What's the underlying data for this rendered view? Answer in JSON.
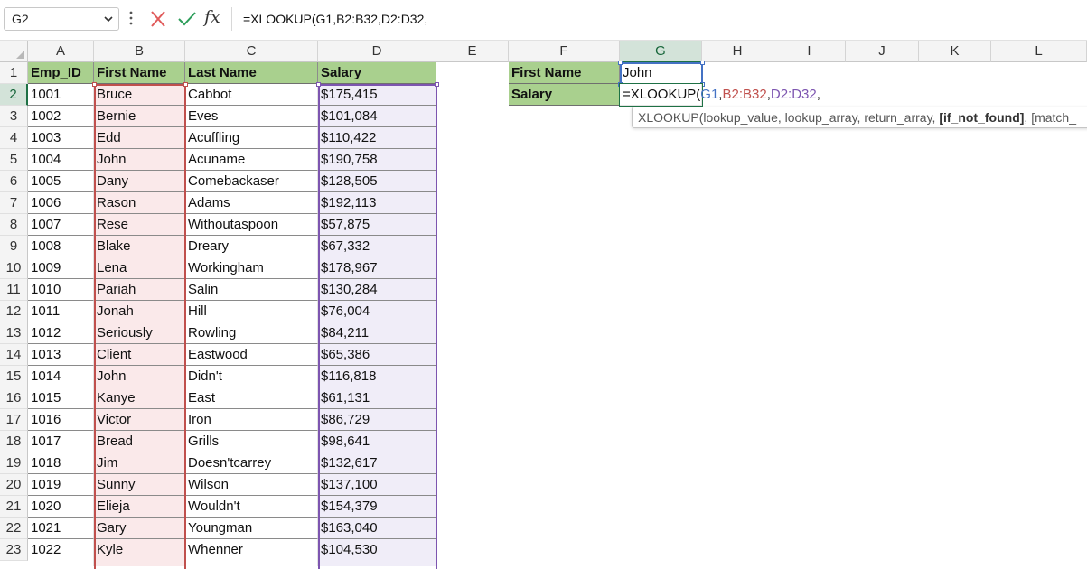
{
  "formula_bar": {
    "name_box": "G2",
    "formula": "=XLOOKUP(G1,B2:B32,D2:D32,",
    "icons": [
      "chevron-down-icon",
      "more-vertical-icon",
      "cancel-icon",
      "enter-check-icon",
      "insert-function-icon"
    ]
  },
  "columns": [
    "A",
    "B",
    "C",
    "D",
    "E",
    "F",
    "G",
    "H",
    "I",
    "J",
    "K",
    "L"
  ],
  "rows": [
    "1",
    "2",
    "3",
    "4",
    "5",
    "6",
    "7",
    "8",
    "9",
    "10",
    "11",
    "12",
    "13",
    "14",
    "15",
    "16",
    "17",
    "18",
    "19",
    "20",
    "21",
    "22",
    "23"
  ],
  "headers": {
    "emp_id": "Emp_ID",
    "first_name": "First Name",
    "last_name": "Last Name",
    "salary": "Salary"
  },
  "employees": [
    {
      "id": "1001",
      "first": "Bruce",
      "last": "Cabbot",
      "salary": "$175,415"
    },
    {
      "id": "1002",
      "first": "Bernie",
      "last": "Eves",
      "salary": "$101,084"
    },
    {
      "id": "1003",
      "first": "Edd",
      "last": "Acuffling",
      "salary": "$110,422"
    },
    {
      "id": "1004",
      "first": "John",
      "last": "Acuname",
      "salary": "$190,758"
    },
    {
      "id": "1005",
      "first": "Dany",
      "last": "Comebackaser",
      "salary": "$128,505"
    },
    {
      "id": "1006",
      "first": "Rason",
      "last": "Adams",
      "salary": "$192,113"
    },
    {
      "id": "1007",
      "first": "Rese",
      "last": "Withoutaspoon",
      "salary": "$57,875"
    },
    {
      "id": "1008",
      "first": "Blake",
      "last": "Dreary",
      "salary": "$67,332"
    },
    {
      "id": "1009",
      "first": "Lena",
      "last": "Workingham",
      "salary": "$178,967"
    },
    {
      "id": "1010",
      "first": "Pariah",
      "last": "Salin",
      "salary": "$130,284"
    },
    {
      "id": "1011",
      "first": "Jonah",
      "last": "Hill",
      "salary": "$76,004"
    },
    {
      "id": "1012",
      "first": "Seriously",
      "last": "Rowling",
      "salary": "$84,211"
    },
    {
      "id": "1013",
      "first": "Client",
      "last": "Eastwood",
      "salary": "$65,386"
    },
    {
      "id": "1014",
      "first": "John",
      "last": "Didn't",
      "salary": "$116,818"
    },
    {
      "id": "1015",
      "first": "Kanye",
      "last": "East",
      "salary": "$61,131"
    },
    {
      "id": "1016",
      "first": "Victor",
      "last": "Iron",
      "salary": "$86,729"
    },
    {
      "id": "1017",
      "first": "Bread",
      "last": "Grills",
      "salary": "$98,641"
    },
    {
      "id": "1018",
      "first": "Jim",
      "last": "Doesn'tcarrey",
      "salary": "$132,617"
    },
    {
      "id": "1019",
      "first": "Sunny",
      "last": "Wilson",
      "salary": "$137,100"
    },
    {
      "id": "1020",
      "first": "Elieja",
      "last": "Wouldn't",
      "salary": "$154,379"
    },
    {
      "id": "1021",
      "first": "Gary",
      "last": "Youngman",
      "salary": "$163,040"
    },
    {
      "id": "1022",
      "first": "Kyle",
      "last": "Whenner",
      "salary": "$104,530"
    }
  ],
  "lookup": {
    "first_name_label": "First Name",
    "first_name_value": "John",
    "salary_label": "Salary",
    "editing": {
      "prefix": "=XLOOKUP(",
      "ref1": "G1",
      "sep1": ",",
      "ref2": "B2:B32",
      "sep2": ",",
      "ref3": "D2:D32",
      "sep3": ","
    }
  },
  "tooltip": {
    "func": "XLOOKUP(",
    "args": "lookup_value, lookup_array, return_array, ",
    "bold_arg": "[if_not_found]",
    "rest": ", [match_"
  },
  "colors": {
    "header_green": "#a9d08e",
    "range_red": "#c0504d",
    "range_purple": "#7d55b0",
    "range_blue": "#4472c4",
    "excel_green": "#1e7145"
  }
}
